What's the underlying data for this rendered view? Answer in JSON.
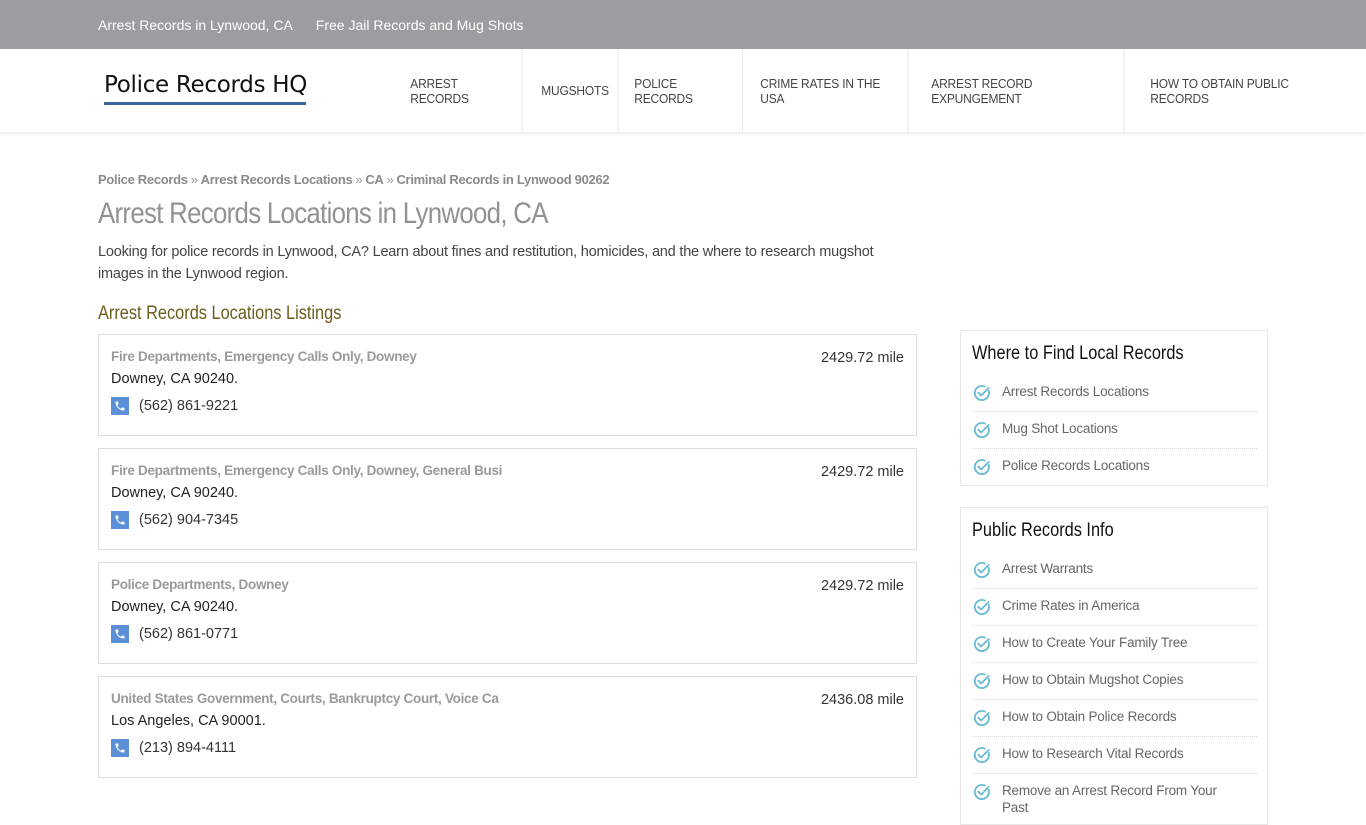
{
  "topbar": {
    "links": [
      "Arrest Records in Lynwood, CA",
      "Free Jail Records and Mug Shots"
    ]
  },
  "header": {
    "logo_text": "Police Records HQ",
    "nav": [
      "Arrest Records",
      "Mugshots",
      "Police Records",
      "Crime Rates in the USA",
      "Arrest Record Expungement",
      "How to Obtain Public Records"
    ]
  },
  "breadcrumb": {
    "items": [
      "Police Records",
      "Arrest Records Locations",
      "CA",
      "Criminal Records in Lynwood 90262"
    ],
    "separator": "»"
  },
  "main": {
    "title": "Arrest Records Locations in Lynwood, CA",
    "intro": "Looking for police records in Lynwood, CA? Learn about fines and restitution, homicides, and the where to research mugshot images in the Lynwood region.",
    "section_title": "Arrest Records Locations Listings",
    "listings": [
      {
        "name": "Fire Departments, Emergency Calls Only, Downey",
        "address": "Downey, CA 90240.",
        "phone": "(562) 861-9221",
        "distance": "2429.72 mile"
      },
      {
        "name": "Fire Departments, Emergency Calls Only, Downey, General Busi",
        "address": "Downey, CA 90240.",
        "phone": "(562) 904-7345",
        "distance": "2429.72 mile"
      },
      {
        "name": "Police Departments, Downey",
        "address": "Downey, CA 90240.",
        "phone": "(562) 861-0771",
        "distance": "2429.72 mile"
      },
      {
        "name": "United States Government, Courts, Bankruptcy Court, Voice Ca",
        "address": "Los Angeles, CA 90001.",
        "phone": "(213) 894-4111",
        "distance": "2436.08 mile"
      }
    ]
  },
  "sidebar": {
    "widgets": [
      {
        "title": "Where to Find Local Records",
        "items": [
          "Arrest Records Locations",
          "Mug Shot Locations",
          "Police Records Locations"
        ]
      },
      {
        "title": "Public Records Info",
        "items": [
          "Arrest Warrants",
          "Crime Rates in America",
          "How to Create Your Family Tree",
          "How to Obtain Mugshot Copies",
          "How to Obtain Police Records",
          "How to Research Vital Records",
          "Remove an Arrest Record From Your Past"
        ]
      }
    ]
  },
  "colors": {
    "topbar": "#9a9ea2",
    "logo_underline": "#3a679b",
    "section_title": "#6b5d1c",
    "phone_icon": "#5b8fd6",
    "check_icon": "#6bbad3"
  }
}
